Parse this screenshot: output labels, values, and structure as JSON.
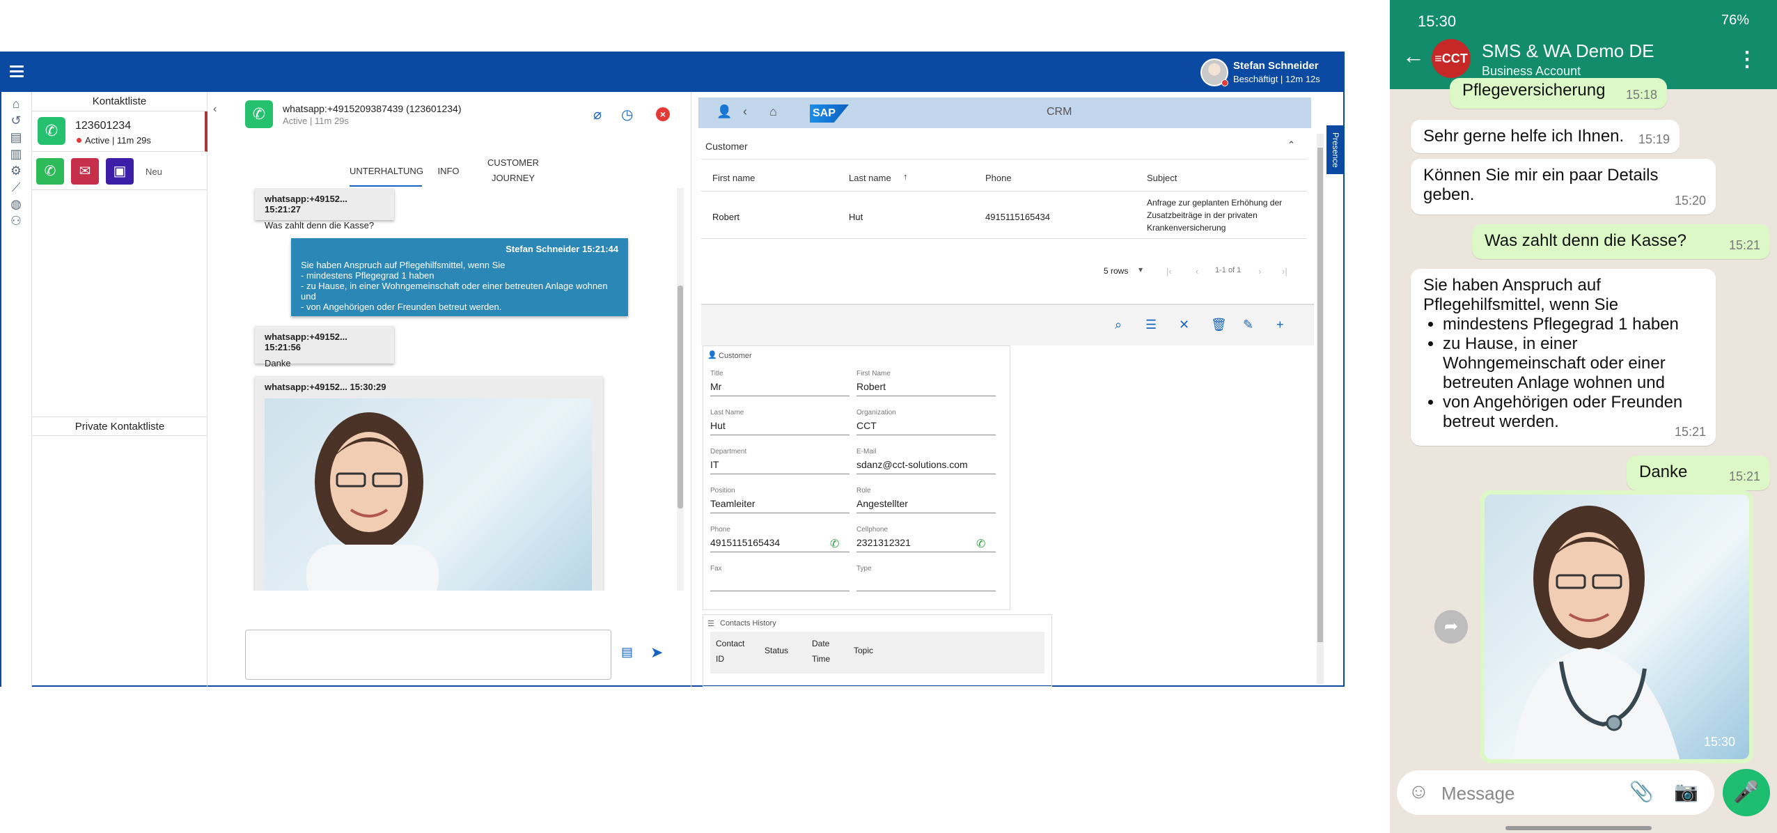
{
  "desktop": {
    "user": {
      "name": "Stefan Schneider",
      "status": "Beschäftigt | 12m 12s"
    },
    "contacts": {
      "header": "Kontaktliste",
      "item": {
        "number": "123601234",
        "state": "Active | 11m 29s"
      },
      "new_label": "Neu",
      "private_header": "Private Kontaktliste"
    },
    "conversation": {
      "title": "whatsapp:+4915209387439 (123601234)",
      "subtitle": "Active | 11m 29s",
      "tabs": [
        "UNTERHALTUNG",
        "INFO",
        "CUSTOMER",
        "JOURNEY"
      ],
      "messages": [
        {
          "meta": "whatsapp:+49152... 15:21:27",
          "text": "Was zahlt denn die Kasse?"
        },
        {
          "meta": "Stefan Schneider 15:21:44",
          "lines": [
            "Sie haben Anspruch auf Pflegehilfsmittel, wenn Sie",
            "- mindestens Pflegegrad 1 haben",
            "- zu Hause, in einer Wohngemeinschaft oder einer betreuten Anlage wohnen und",
            "- von Angehörigen oder Freunden betreut werden."
          ]
        },
        {
          "meta": "whatsapp:+49152... 15:21:56",
          "text": "Danke"
        },
        {
          "meta": "whatsapp:+49152... 15:30:29"
        }
      ]
    },
    "crm": {
      "title": "CRM",
      "sap": "SAP",
      "presence": "Presence",
      "section": "Customer",
      "columns": [
        "First name",
        "Last name",
        "Phone",
        "Subject"
      ],
      "row": {
        "first": "Robert",
        "last": "Hut",
        "phone": "4915115165434",
        "subject_lines": [
          "Anfrage zur geplanten Erhöhung der",
          "Zusatzbeiträge in der privaten",
          "Krankenversicherung"
        ]
      },
      "pager": {
        "rows": "5 rows",
        "range": "1-1 of 1"
      },
      "detail_title": "Customer",
      "fields": [
        {
          "label": "Title",
          "value": "Mr"
        },
        {
          "label": "First Name",
          "value": "Robert"
        },
        {
          "label": "Last Name",
          "value": "Hut"
        },
        {
          "label": "Organization",
          "value": "CCT"
        },
        {
          "label": "Department",
          "value": "IT"
        },
        {
          "label": "E-Mail",
          "value": "sdanz@cct-solutions.com"
        },
        {
          "label": "Position",
          "value": "Teamleiter"
        },
        {
          "label": "Role",
          "value": "Angestellter"
        },
        {
          "label": "Phone",
          "value": "4915115165434"
        },
        {
          "label": "Cellphone",
          "value": "2321312321"
        },
        {
          "label": "Fax",
          "value": ""
        },
        {
          "label": "Type",
          "value": ""
        }
      ],
      "history": {
        "title": "Contacts History",
        "columns": [
          "Contact ID",
          "Status",
          "Date Time",
          "Topic"
        ],
        "col_lines": [
          [
            "Contact",
            "ID"
          ],
          [
            "Status"
          ],
          [
            "Date",
            "Time"
          ],
          [
            "Topic"
          ]
        ]
      }
    }
  },
  "phone": {
    "status_time": "15:30",
    "status_right": "76%",
    "chat_name": "SMS & WA Demo DE",
    "chat_sub": "Business Account",
    "avatar_text": "≡CCT",
    "bubbles": {
      "top_partial": "Pflegeversicherung",
      "top_partial_time": "15:18",
      "b1": "Sehr gerne helfe ich Ihnen.",
      "b1_time": "15:19",
      "b2": "Können Sie mir ein paar Details geben.",
      "b2_time": "15:20",
      "b3": "Was zahlt denn die Kasse?",
      "b3_time": "15:21",
      "b4_intro": "Sie haben Anspruch auf Pflegehilfsmittel, wenn Sie",
      "b4_items": [
        "mindestens Pflegegrad 1 haben",
        "zu Hause, in einer Wohngemeinschaft oder einer betreuten Anlage wohnen und",
        "von Angehörigen oder Freunden betreut werden."
      ],
      "b4_time": "15:21",
      "b5": "Danke",
      "b5_time": "15:21",
      "img_time": "15:30"
    },
    "input_placeholder": "Message"
  }
}
